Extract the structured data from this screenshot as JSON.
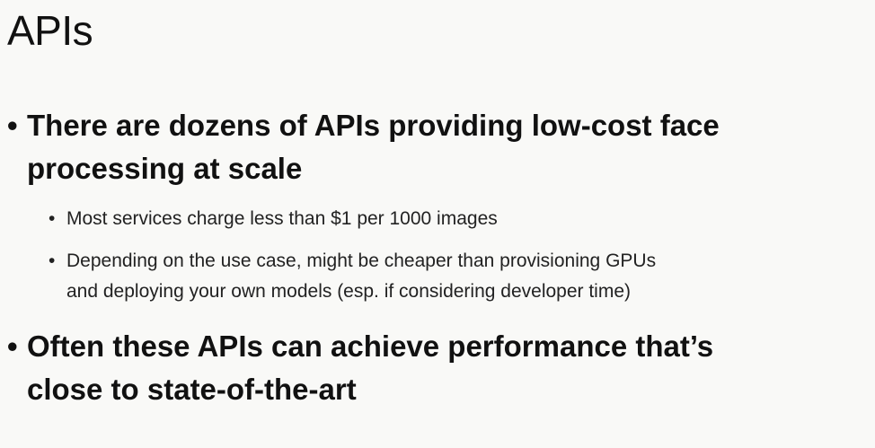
{
  "slide": {
    "title": "APIs",
    "bullet_glyph": "•",
    "bullets": [
      {
        "line1": "There are dozens of APIs providing low-cost face",
        "line2": "processing at scale",
        "sub": [
          {
            "line1": "Most services charge less than $1 per 1000 images"
          },
          {
            "line1": "Depending on the use case, might be cheaper than provisioning GPUs",
            "line2": "and deploying your own models (esp. if considering developer time)"
          }
        ]
      },
      {
        "line1": "Often these APIs can achieve performance that’s",
        "line2": "close to state-of-the-art"
      }
    ]
  }
}
